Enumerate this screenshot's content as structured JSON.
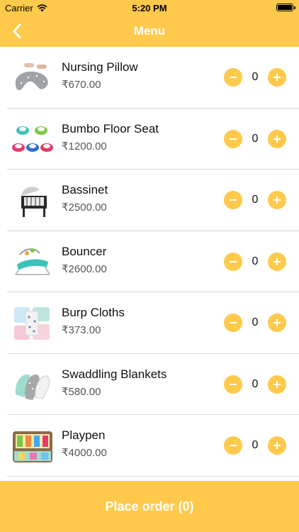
{
  "status": {
    "carrier": "Carrier",
    "time": "5:20 PM"
  },
  "nav": {
    "title": "Menu"
  },
  "items": [
    {
      "name": "Nursing Pillow",
      "price": "₹670.00",
      "qty": "0",
      "icon": "nursing-pillow"
    },
    {
      "name": "Bumbo Floor Seat",
      "price": "₹1200.00",
      "qty": "0",
      "icon": "floor-seat"
    },
    {
      "name": "Bassinet",
      "price": "₹2500.00",
      "qty": "0",
      "icon": "bassinet"
    },
    {
      "name": "Bouncer",
      "price": "₹2600.00",
      "qty": "0",
      "icon": "bouncer"
    },
    {
      "name": "Burp Cloths",
      "price": "₹373.00",
      "qty": "0",
      "icon": "burp-cloths"
    },
    {
      "name": "Swaddling Blankets",
      "price": "₹580.00",
      "qty": "0",
      "icon": "swaddle"
    },
    {
      "name": "Playpen",
      "price": "₹4000.00",
      "qty": "0",
      "icon": "playpen"
    }
  ],
  "footer": {
    "order_label": "Place order (0)"
  },
  "colors": {
    "accent": "#FFC94B"
  }
}
